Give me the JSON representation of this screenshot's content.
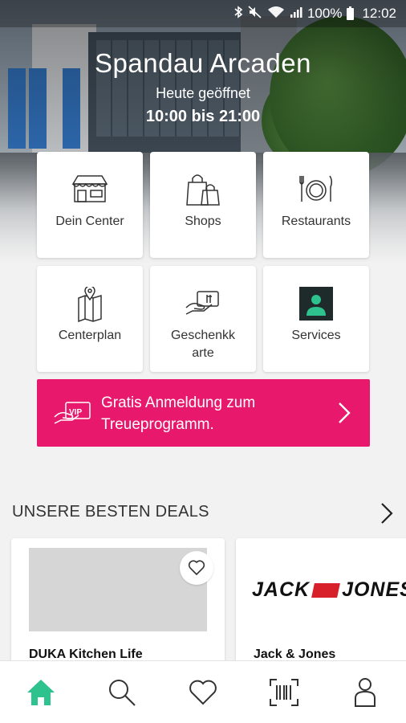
{
  "status_bar": {
    "battery": "100%",
    "time": "12:02"
  },
  "header": {
    "center_name": "Spandau Arcaden",
    "open_label": "Heute geöffnet",
    "hours": "10:00 bis 21:00"
  },
  "tiles": [
    {
      "label": "Dein Center",
      "icon": "storefront-icon"
    },
    {
      "label": "Shops",
      "icon": "shopping-bags-icon"
    },
    {
      "label": "Restaurants",
      "icon": "plate-cutlery-icon"
    },
    {
      "label": "Centerplan",
      "icon": "map-pin-icon"
    },
    {
      "label": "Geschenkk\narte",
      "icon": "gift-card-icon"
    },
    {
      "label": "Services",
      "icon": "service-person-icon"
    }
  ],
  "vip_banner": {
    "text": "Gratis Anmeldung zum Treueprogramm.",
    "icon_text": "VIP"
  },
  "deals": {
    "title": "UNSERE BESTEN DEALS",
    "cards": [
      {
        "name": "DUKA Kitchen Life"
      },
      {
        "name": "Jack & Jones",
        "logo": "JACK & JONES"
      }
    ]
  },
  "colors": {
    "accent": "#e8196c",
    "nav_active": "#2ec28f",
    "services_icon_bg": "#1f2a2a"
  },
  "nav": [
    {
      "name": "home",
      "icon": "home-icon",
      "active": true
    },
    {
      "name": "search",
      "icon": "search-icon"
    },
    {
      "name": "favorites",
      "icon": "heart-icon"
    },
    {
      "name": "scan",
      "icon": "barcode-scan-icon"
    },
    {
      "name": "profile",
      "icon": "person-icon"
    }
  ]
}
